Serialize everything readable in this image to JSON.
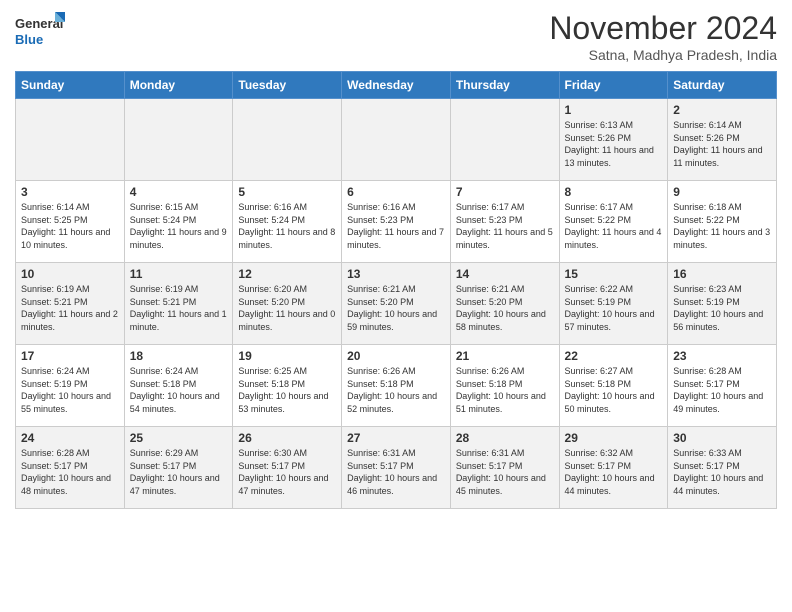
{
  "logo": {
    "line1": "General",
    "line2": "Blue"
  },
  "title": "November 2024",
  "subtitle": "Satna, Madhya Pradesh, India",
  "headers": [
    "Sunday",
    "Monday",
    "Tuesday",
    "Wednesday",
    "Thursday",
    "Friday",
    "Saturday"
  ],
  "weeks": [
    [
      {
        "day": "",
        "info": ""
      },
      {
        "day": "",
        "info": ""
      },
      {
        "day": "",
        "info": ""
      },
      {
        "day": "",
        "info": ""
      },
      {
        "day": "",
        "info": ""
      },
      {
        "day": "1",
        "info": "Sunrise: 6:13 AM\nSunset: 5:26 PM\nDaylight: 11 hours and 13 minutes."
      },
      {
        "day": "2",
        "info": "Sunrise: 6:14 AM\nSunset: 5:26 PM\nDaylight: 11 hours and 11 minutes."
      }
    ],
    [
      {
        "day": "3",
        "info": "Sunrise: 6:14 AM\nSunset: 5:25 PM\nDaylight: 11 hours and 10 minutes."
      },
      {
        "day": "4",
        "info": "Sunrise: 6:15 AM\nSunset: 5:24 PM\nDaylight: 11 hours and 9 minutes."
      },
      {
        "day": "5",
        "info": "Sunrise: 6:16 AM\nSunset: 5:24 PM\nDaylight: 11 hours and 8 minutes."
      },
      {
        "day": "6",
        "info": "Sunrise: 6:16 AM\nSunset: 5:23 PM\nDaylight: 11 hours and 7 minutes."
      },
      {
        "day": "7",
        "info": "Sunrise: 6:17 AM\nSunset: 5:23 PM\nDaylight: 11 hours and 5 minutes."
      },
      {
        "day": "8",
        "info": "Sunrise: 6:17 AM\nSunset: 5:22 PM\nDaylight: 11 hours and 4 minutes."
      },
      {
        "day": "9",
        "info": "Sunrise: 6:18 AM\nSunset: 5:22 PM\nDaylight: 11 hours and 3 minutes."
      }
    ],
    [
      {
        "day": "10",
        "info": "Sunrise: 6:19 AM\nSunset: 5:21 PM\nDaylight: 11 hours and 2 minutes."
      },
      {
        "day": "11",
        "info": "Sunrise: 6:19 AM\nSunset: 5:21 PM\nDaylight: 11 hours and 1 minute."
      },
      {
        "day": "12",
        "info": "Sunrise: 6:20 AM\nSunset: 5:20 PM\nDaylight: 11 hours and 0 minutes."
      },
      {
        "day": "13",
        "info": "Sunrise: 6:21 AM\nSunset: 5:20 PM\nDaylight: 10 hours and 59 minutes."
      },
      {
        "day": "14",
        "info": "Sunrise: 6:21 AM\nSunset: 5:20 PM\nDaylight: 10 hours and 58 minutes."
      },
      {
        "day": "15",
        "info": "Sunrise: 6:22 AM\nSunset: 5:19 PM\nDaylight: 10 hours and 57 minutes."
      },
      {
        "day": "16",
        "info": "Sunrise: 6:23 AM\nSunset: 5:19 PM\nDaylight: 10 hours and 56 minutes."
      }
    ],
    [
      {
        "day": "17",
        "info": "Sunrise: 6:24 AM\nSunset: 5:19 PM\nDaylight: 10 hours and 55 minutes."
      },
      {
        "day": "18",
        "info": "Sunrise: 6:24 AM\nSunset: 5:18 PM\nDaylight: 10 hours and 54 minutes."
      },
      {
        "day": "19",
        "info": "Sunrise: 6:25 AM\nSunset: 5:18 PM\nDaylight: 10 hours and 53 minutes."
      },
      {
        "day": "20",
        "info": "Sunrise: 6:26 AM\nSunset: 5:18 PM\nDaylight: 10 hours and 52 minutes."
      },
      {
        "day": "21",
        "info": "Sunrise: 6:26 AM\nSunset: 5:18 PM\nDaylight: 10 hours and 51 minutes."
      },
      {
        "day": "22",
        "info": "Sunrise: 6:27 AM\nSunset: 5:18 PM\nDaylight: 10 hours and 50 minutes."
      },
      {
        "day": "23",
        "info": "Sunrise: 6:28 AM\nSunset: 5:17 PM\nDaylight: 10 hours and 49 minutes."
      }
    ],
    [
      {
        "day": "24",
        "info": "Sunrise: 6:28 AM\nSunset: 5:17 PM\nDaylight: 10 hours and 48 minutes."
      },
      {
        "day": "25",
        "info": "Sunrise: 6:29 AM\nSunset: 5:17 PM\nDaylight: 10 hours and 47 minutes."
      },
      {
        "day": "26",
        "info": "Sunrise: 6:30 AM\nSunset: 5:17 PM\nDaylight: 10 hours and 47 minutes."
      },
      {
        "day": "27",
        "info": "Sunrise: 6:31 AM\nSunset: 5:17 PM\nDaylight: 10 hours and 46 minutes."
      },
      {
        "day": "28",
        "info": "Sunrise: 6:31 AM\nSunset: 5:17 PM\nDaylight: 10 hours and 45 minutes."
      },
      {
        "day": "29",
        "info": "Sunrise: 6:32 AM\nSunset: 5:17 PM\nDaylight: 10 hours and 44 minutes."
      },
      {
        "day": "30",
        "info": "Sunrise: 6:33 AM\nSunset: 5:17 PM\nDaylight: 10 hours and 44 minutes."
      }
    ]
  ]
}
